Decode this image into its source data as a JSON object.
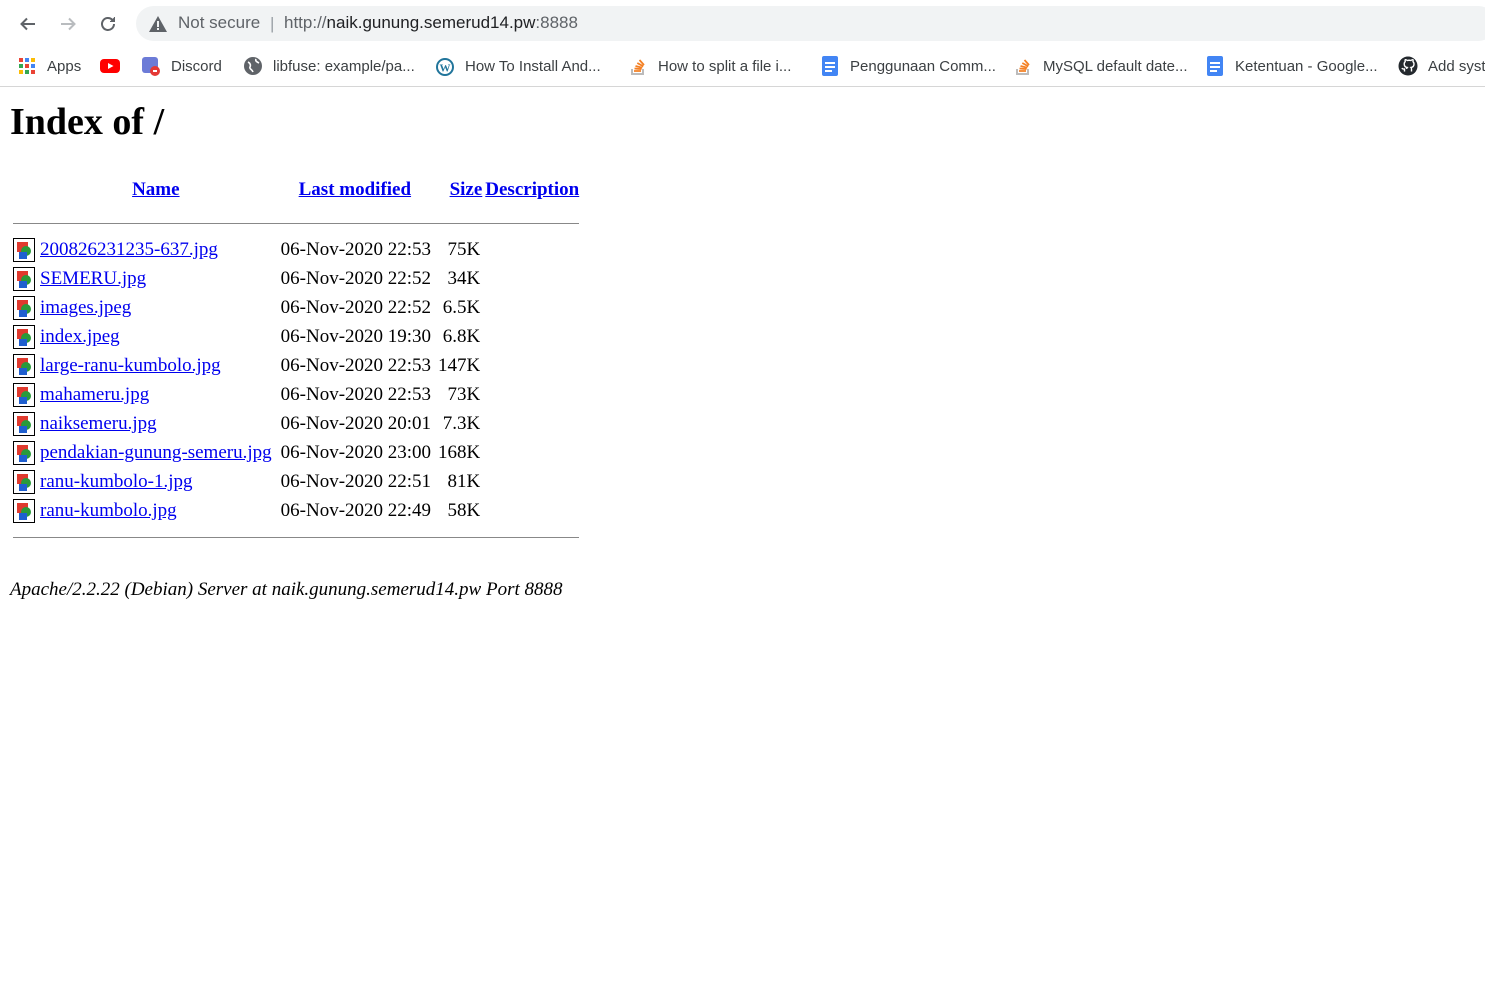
{
  "browser": {
    "security_status": "Not secure",
    "url_scheme": "http://",
    "url_host": "naik.gunung.semerud14.pw",
    "url_port": ":8888",
    "bookmarks": [
      {
        "label": "Apps",
        "icon": "apps-grid-icon"
      },
      {
        "label": "",
        "icon": "youtube-icon"
      },
      {
        "label": "Discord",
        "icon": "discord-icon"
      },
      {
        "label": "libfuse: example/pa...",
        "icon": "globe-icon"
      },
      {
        "label": "How To Install And...",
        "icon": "wordpress-icon"
      },
      {
        "label": "How to split a file i...",
        "icon": "stackoverflow-icon"
      },
      {
        "label": "Penggunaan Comm...",
        "icon": "google-docs-icon"
      },
      {
        "label": "MySQL default date...",
        "icon": "stackoverflow-icon"
      },
      {
        "label": "Ketentuan - Google...",
        "icon": "google-docs-icon"
      },
      {
        "label": "Add syst",
        "icon": "github-icon"
      }
    ]
  },
  "page": {
    "title": "Index of /",
    "columns": {
      "name": "Name",
      "last_modified": "Last modified",
      "size": "Size",
      "description": "Description"
    },
    "files": [
      {
        "name": "200826231235-637.jpg",
        "modified": "06-Nov-2020 22:53",
        "size": "75K",
        "description": ""
      },
      {
        "name": "SEMERU.jpg",
        "modified": "06-Nov-2020 22:52",
        "size": "34K",
        "description": ""
      },
      {
        "name": "images.jpeg",
        "modified": "06-Nov-2020 22:52",
        "size": "6.5K",
        "description": ""
      },
      {
        "name": "index.jpeg",
        "modified": "06-Nov-2020 19:30",
        "size": "6.8K",
        "description": ""
      },
      {
        "name": "large-ranu-kumbolo.jpg",
        "modified": "06-Nov-2020 22:53",
        "size": "147K",
        "description": ""
      },
      {
        "name": "mahameru.jpg",
        "modified": "06-Nov-2020 22:53",
        "size": "73K",
        "description": ""
      },
      {
        "name": "naiksemeru.jpg",
        "modified": "06-Nov-2020 20:01",
        "size": "7.3K",
        "description": ""
      },
      {
        "name": "pendakian-gunung-semeru.jpg",
        "modified": "06-Nov-2020 23:00",
        "size": "168K",
        "description": ""
      },
      {
        "name": "ranu-kumbolo-1.jpg",
        "modified": "06-Nov-2020 22:51",
        "size": "81K",
        "description": ""
      },
      {
        "name": "ranu-kumbolo.jpg",
        "modified": "06-Nov-2020 22:49",
        "size": "58K",
        "description": ""
      }
    ],
    "footer": "Apache/2.2.22 (Debian) Server at naik.gunung.semerud14.pw Port 8888"
  }
}
